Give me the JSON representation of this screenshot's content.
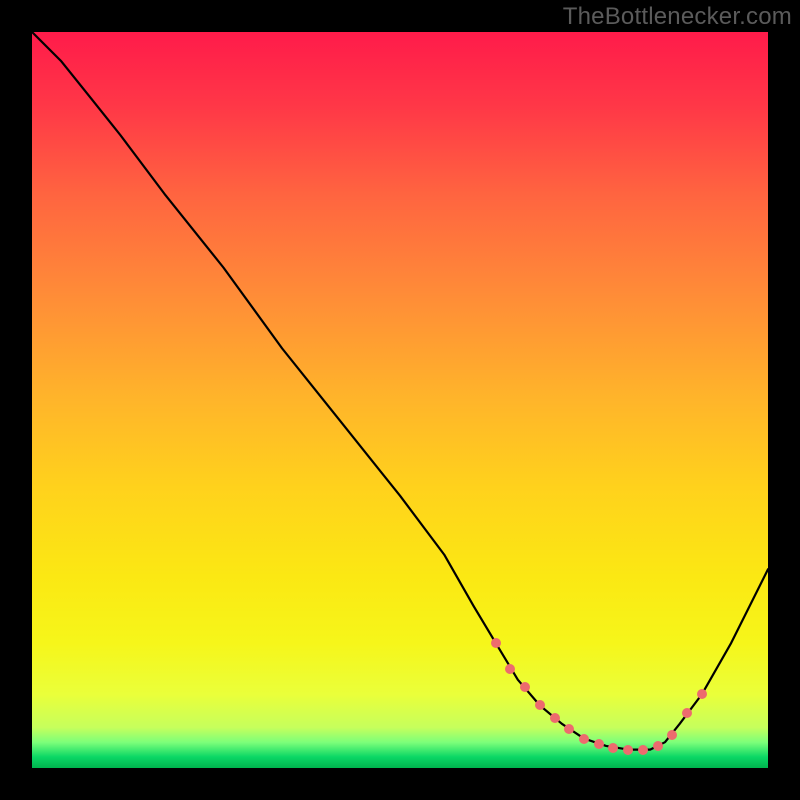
{
  "watermark": "TheBottlenecker.com",
  "colors": {
    "dot": "#ed6b6e",
    "curve": "#000000"
  },
  "gradient_stops": [
    {
      "offset": 0.0,
      "color": "#ff1b4a"
    },
    {
      "offset": 0.1,
      "color": "#ff3747"
    },
    {
      "offset": 0.22,
      "color": "#ff6440"
    },
    {
      "offset": 0.35,
      "color": "#ff8a38"
    },
    {
      "offset": 0.5,
      "color": "#ffb52a"
    },
    {
      "offset": 0.62,
      "color": "#ffd21c"
    },
    {
      "offset": 0.74,
      "color": "#fbe813"
    },
    {
      "offset": 0.83,
      "color": "#f6f61a"
    },
    {
      "offset": 0.9,
      "color": "#eaff3a"
    },
    {
      "offset": 0.945,
      "color": "#c6ff5c"
    },
    {
      "offset": 0.965,
      "color": "#7dff7a"
    },
    {
      "offset": 0.985,
      "color": "#0bd765"
    },
    {
      "offset": 1.0,
      "color": "#00b44e"
    }
  ],
  "chart_data": {
    "type": "line",
    "title": "",
    "xlabel": "",
    "ylabel": "",
    "xlim": [
      0,
      100
    ],
    "ylim": [
      0,
      100
    ],
    "x": [
      0,
      4,
      8,
      12,
      18,
      26,
      34,
      42,
      50,
      56,
      60,
      63,
      66,
      69,
      72,
      75,
      78,
      81,
      84,
      86,
      88,
      91,
      95,
      100
    ],
    "y": [
      100,
      96,
      91,
      86,
      78,
      68,
      57,
      47,
      37,
      29,
      22,
      17,
      12,
      8.5,
      6.0,
      4.0,
      3.0,
      2.5,
      2.5,
      3.5,
      6.0,
      10,
      17,
      27
    ],
    "highlight_x": [
      63,
      65,
      67,
      69,
      71,
      73,
      75,
      77,
      79,
      81,
      83,
      85,
      87,
      89,
      91
    ],
    "highlight_y": [
      17,
      13.5,
      11,
      8.5,
      6.8,
      5.3,
      4.0,
      3.2,
      2.7,
      2.5,
      2.5,
      3.0,
      4.5,
      7.5,
      10
    ]
  }
}
